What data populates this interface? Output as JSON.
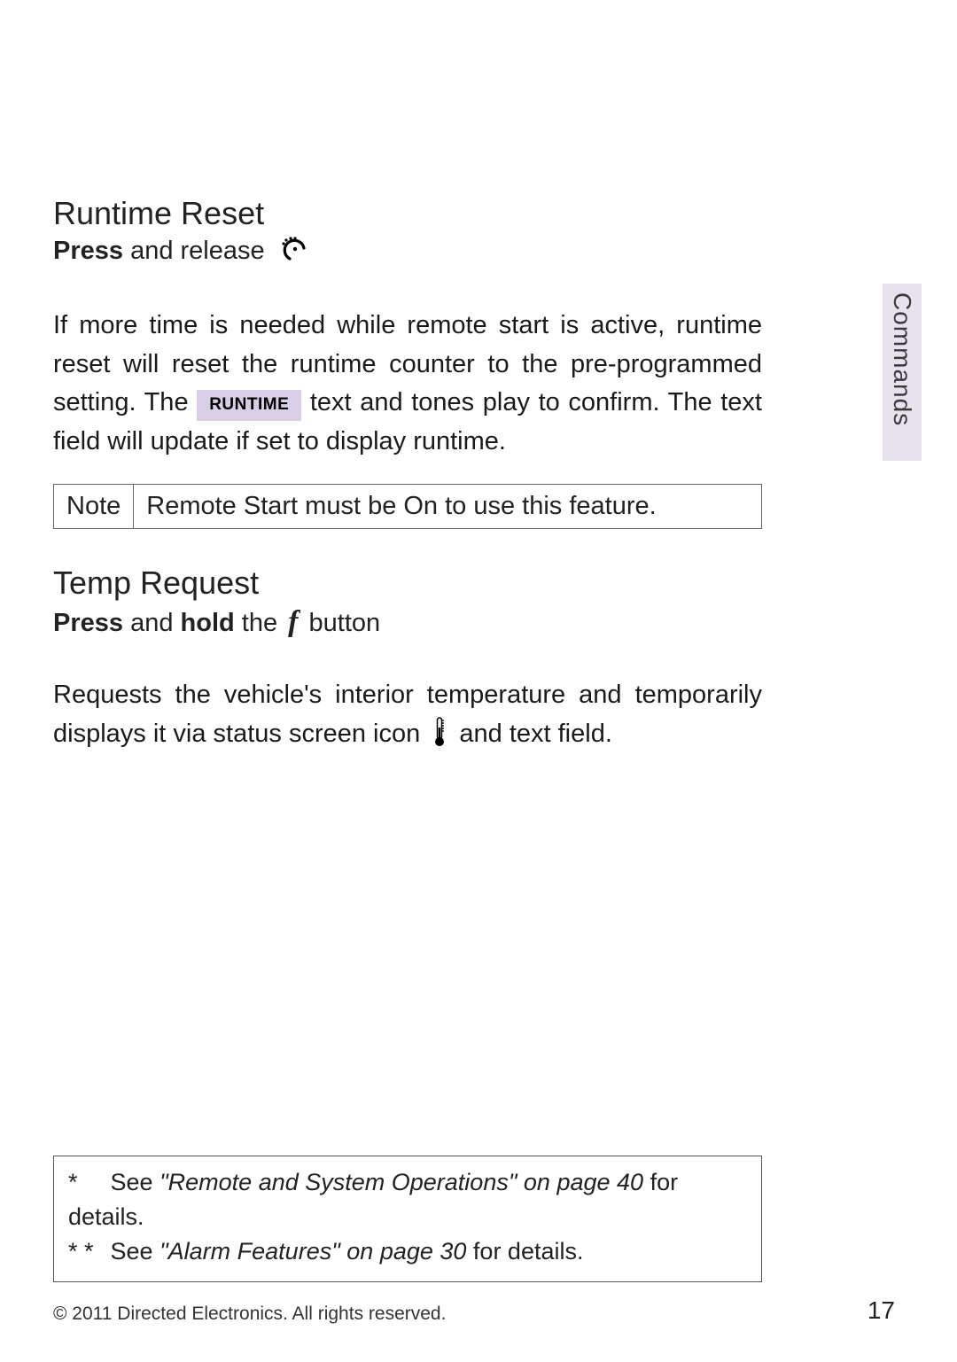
{
  "side_tab": "Commands",
  "section1": {
    "title": "Runtime Reset",
    "instr_prefix_bold": "Press",
    "instr_rest": " and release ",
    "body_before_tag": "If more time is needed while remote start is active, runtime reset will reset the runtime counter to the pre-programmed setting. The ",
    "runtime_tag": "RUNTIME",
    "body_after_tag": " text and tones play to confirm. The text field will update if set to display runtime.",
    "note_label": "Note",
    "note_text": "Remote Start must be On to use this feature."
  },
  "section2": {
    "title": "Temp Request",
    "instr_prefix_bold": "Press",
    "instr_mid": " and ",
    "instr_bold2": "hold",
    "instr_rest": " the ",
    "f_glyph": "f",
    "instr_tail": " button",
    "body_before_icon": "Requests the vehicle's interior temperature and temporarily displays it via status screen icon ",
    "body_after_icon": " and text field."
  },
  "footnotes": {
    "line1_star": "*",
    "line1_pre": "See ",
    "line1_em": "\"Remote and System Operations\" on page 40",
    "line1_post": " for details.",
    "line2_star": "* *",
    "line2_pre": "See ",
    "line2_em": "\"Alarm Features\" on page 30",
    "line2_post": " for details."
  },
  "copyright": "© 2011 Directed Electronics. All rights reserved.",
  "page_number": "17"
}
